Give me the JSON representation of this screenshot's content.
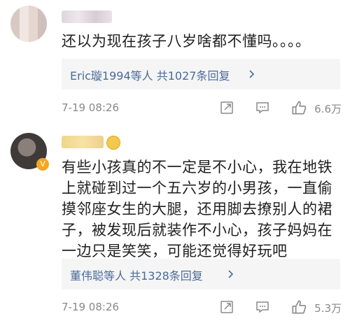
{
  "comments": [
    {
      "text": "还以为现在孩子八岁啥都不懂吗。。。。",
      "reply_summary": "Eric璇1994等人 共1027条回复",
      "time": "7-19 08:26",
      "likes": "6.6万"
    },
    {
      "text": "有些小孩真的不一定是不小心，我在地铁上就碰到过一个五六岁的小男孩，一直偷摸邻座女生的大腿，还用脚去撩别人的裙子，被发现后就装作不小心，孩子妈妈在一边只是笑笑，可能还觉得好玩吧",
      "reply_summary": "董伟聪等人 共1328条回复",
      "time": "7-19 08:26",
      "likes": "5.3万"
    }
  ],
  "icons": {
    "share": "share-icon",
    "comment": "comment-icon",
    "like": "thumbs-up-icon",
    "chevron": "chevron-right-icon"
  }
}
